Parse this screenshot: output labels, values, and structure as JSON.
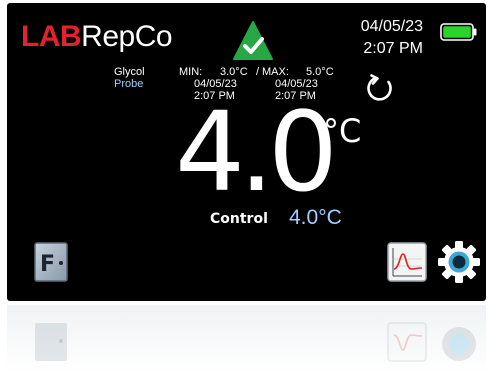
{
  "header": {
    "logo_lab": "LAB",
    "logo_rest": "RepCo",
    "date": "04/05/23",
    "time": "2:07 PM"
  },
  "status": {
    "icon": "check-icon",
    "color": "#27a844"
  },
  "battery": {
    "level": 1.0,
    "color": "#2bd42b"
  },
  "minmax": {
    "source_label": "Glycol",
    "probe_label": "Probe",
    "min_label": "MIN:",
    "min_value": "3.0°C",
    "separator": "/",
    "max_label": "MAX:",
    "max_value": "5.0°C",
    "min_date": "04/05/23",
    "min_time": "2:07 PM",
    "max_date": "04/05/23",
    "max_time": "2:07 PM"
  },
  "reading": {
    "value": "4.0",
    "unit": "°C",
    "control_label": "Control",
    "control_value": "4.0°C"
  },
  "buttons": {
    "door_icon_letter": "F",
    "reset_icon": "refresh-icon",
    "chart_icon": "chart-icon",
    "settings_icon": "gear-icon"
  },
  "colors": {
    "accent_blue": "#9fd0ff",
    "brand_red": "#e0242d",
    "gear_ring": "#3aa8d8"
  }
}
